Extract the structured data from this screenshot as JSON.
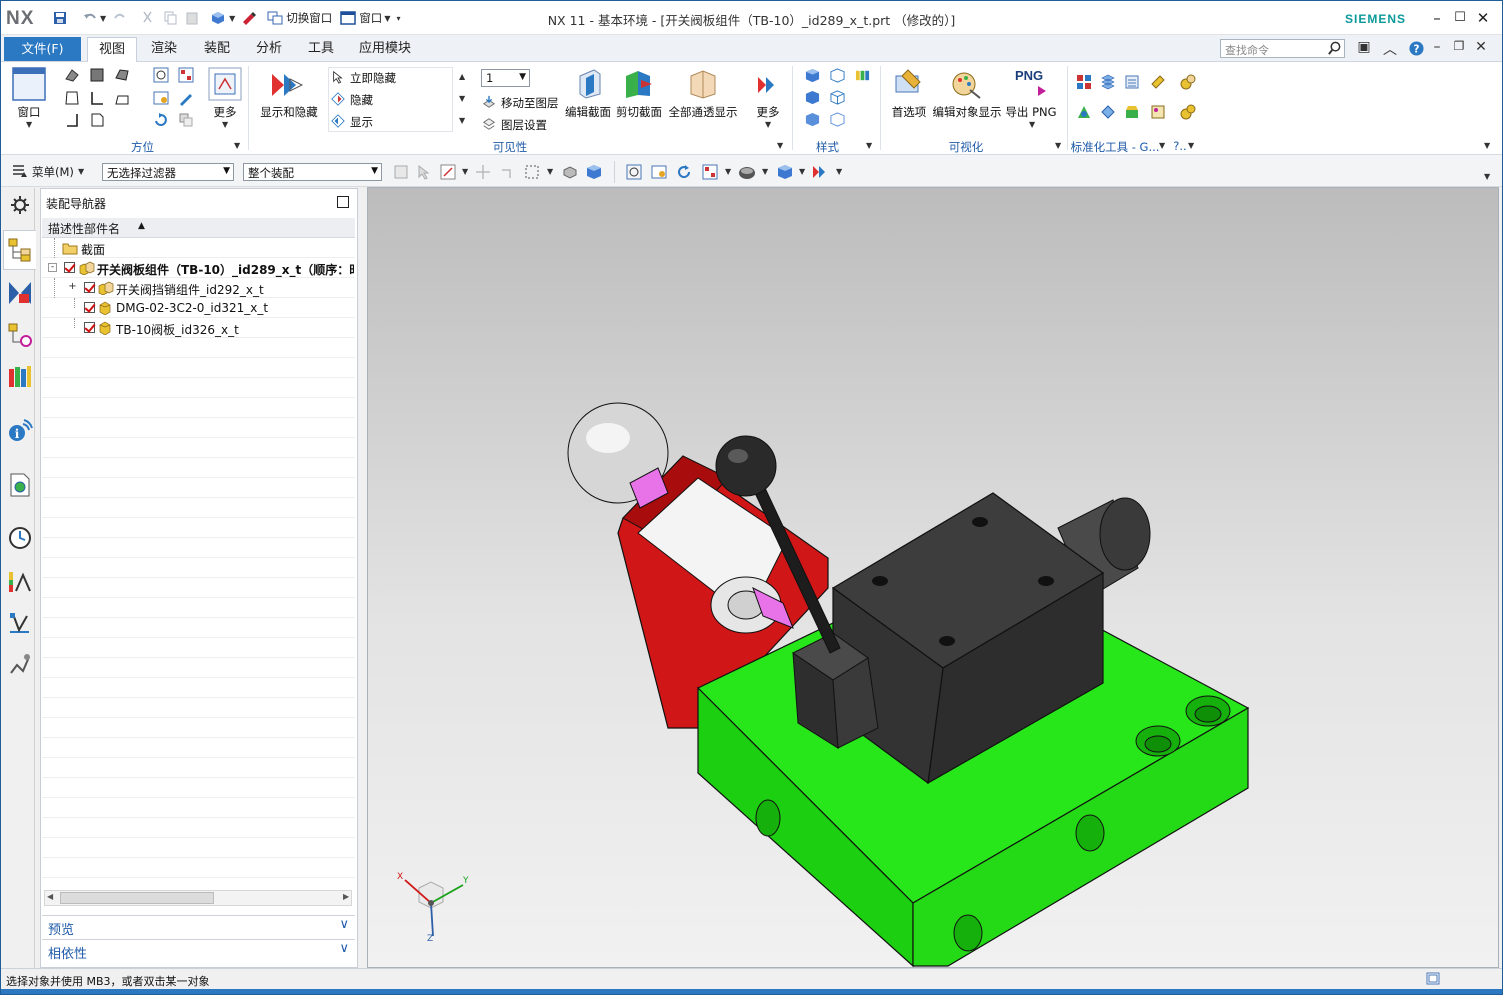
{
  "app": {
    "logo": "NX",
    "title": "NX 11 - 基本环境 - [开关阀板组件（TB-10）_id289_x_t.prt （修改的）]",
    "brand": "SIEMENS",
    "qat": {
      "switch_window": "切换窗口",
      "window": "窗口"
    }
  },
  "ribbon": {
    "file_tab": "文件(F)",
    "tabs": [
      "视图",
      "渲染",
      "装配",
      "分析",
      "工具",
      "应用模块"
    ],
    "active_tab": "视图",
    "search_placeholder": "查找命令",
    "groups": {
      "orientation": {
        "label": "方位",
        "window": "窗口",
        "more": "更多"
      },
      "visibility": {
        "label": "可见性",
        "show_hide": "显示和隐藏",
        "immediate_hide": "立即隐藏",
        "hide": "隐藏",
        "show": "显示",
        "layer_value": "1",
        "move_to_layer": "移动至图层",
        "layer_settings": "图层设置",
        "edit_section": "编辑截面",
        "clip_section": "剪切截面",
        "show_all_through": "全部通透显示",
        "more": "更多"
      },
      "style": {
        "label": "样式"
      },
      "visualization": {
        "label": "可视化",
        "preferences": "首选项",
        "edit_object_display": "编辑对象显示",
        "export_png": "导出 PNG",
        "png_icon": "PNG"
      },
      "std_tools": {
        "label": "标准化工具 - G...",
        "overflow": "?.."
      }
    }
  },
  "toolbar2": {
    "menu": "菜单(M)",
    "filter": "无选择过滤器",
    "scope": "整个装配"
  },
  "navigator": {
    "title": "装配导航器",
    "column_header": "描述性部件名",
    "rows": [
      {
        "label": "截面",
        "kind": "folder"
      },
      {
        "label": "开关阀板组件（TB-10）_id289_x_t（顺序：时...",
        "kind": "assembly-root"
      },
      {
        "label": "开关阀挡销组件_id292_x_t",
        "kind": "subassembly"
      },
      {
        "label": "DMG-02-3C2-0_id321_x_t",
        "kind": "part"
      },
      {
        "label": "TB-10阀板_id326_x_t",
        "kind": "part"
      }
    ],
    "preview": "预览",
    "dependencies": "相依性"
  },
  "viewport": {
    "triad": {
      "x": "X",
      "y": "Y",
      "z": "Z"
    },
    "colors": {
      "base_block": "#22dd11",
      "valve_body": "#3c3c3c",
      "bracket": "#cc1010",
      "pin": "#e873e8",
      "sphere": "#d6d6d6"
    }
  },
  "status": {
    "text": "选择对象并使用 MB3，或者双击某一对象"
  }
}
